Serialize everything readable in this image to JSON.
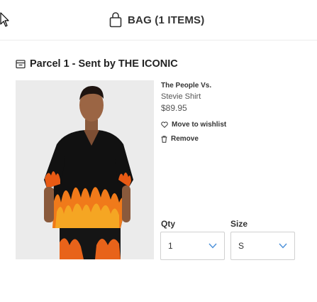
{
  "header": {
    "bag_title": "BAG (1 ITEMS)",
    "bag_icon": "shopping-bag-icon"
  },
  "parcel": {
    "title": "Parcel 1 - Sent by THE ICONIC",
    "icon": "parcel-box-icon"
  },
  "product": {
    "brand": "The People Vs.",
    "name": "Stevie Shirt",
    "price": "$89.95",
    "image_desc": "model-flame-print-shirt-image"
  },
  "actions": {
    "wishlist_label": "Move to wishlist",
    "wishlist_icon": "heart-icon",
    "remove_label": "Remove",
    "remove_icon": "trash-icon"
  },
  "options": {
    "qty_label": "Qty",
    "qty_value": "1",
    "size_label": "Size",
    "size_value": "S"
  },
  "colors": {
    "accent": "#4a90d9",
    "border": "#d0d0d0",
    "text": "#222222"
  }
}
